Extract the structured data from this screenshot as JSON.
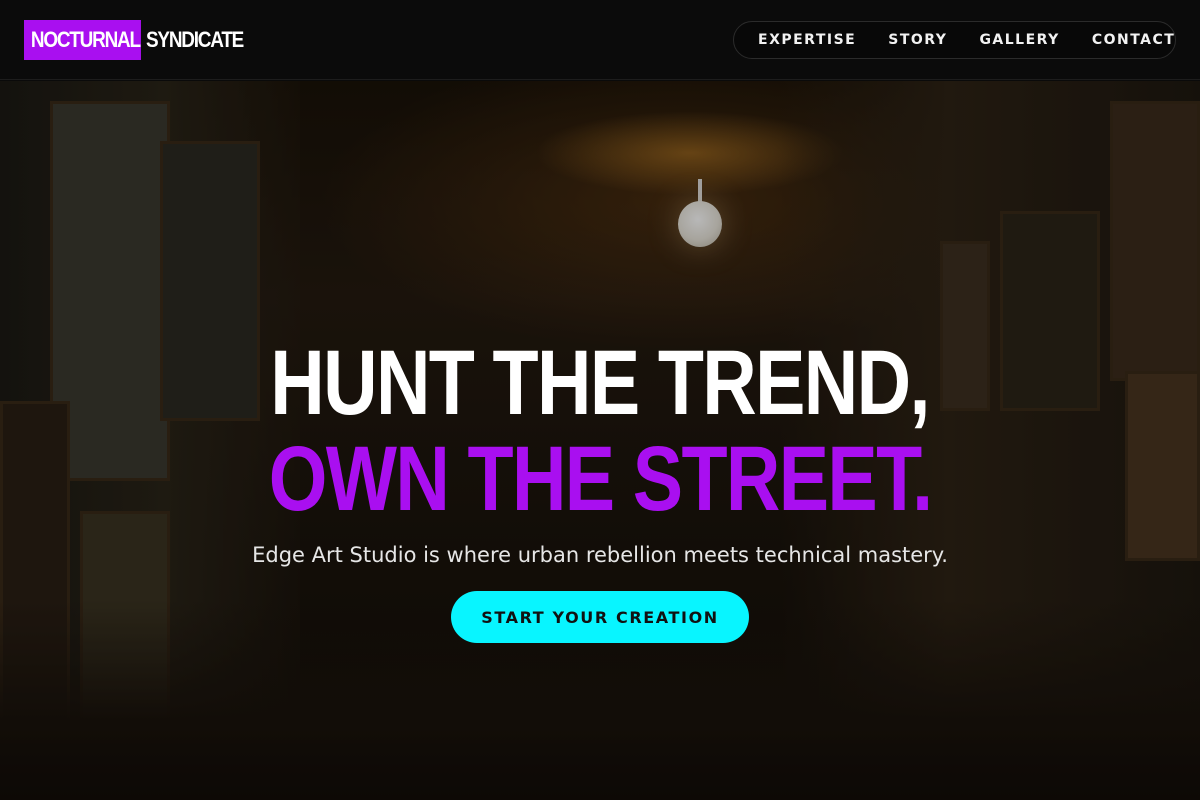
{
  "brand": {
    "part1": "NOCTURNAL",
    "part2": "SYNDICATE",
    "accent_color": "#a90ff0"
  },
  "nav": {
    "items": [
      {
        "label": "EXPERTISE"
      },
      {
        "label": "STORY"
      },
      {
        "label": "GALLERY"
      },
      {
        "label": "CONTACT"
      }
    ]
  },
  "hero": {
    "headline_line1": "HUNT THE TREND,",
    "headline_line2": "OWN THE STREET.",
    "subheading": "Edge Art Studio is where urban rebellion meets technical mastery.",
    "cta_label": "START YOUR CREATION",
    "cta_color": "#08f5ff",
    "background": "art-studio-photo"
  }
}
